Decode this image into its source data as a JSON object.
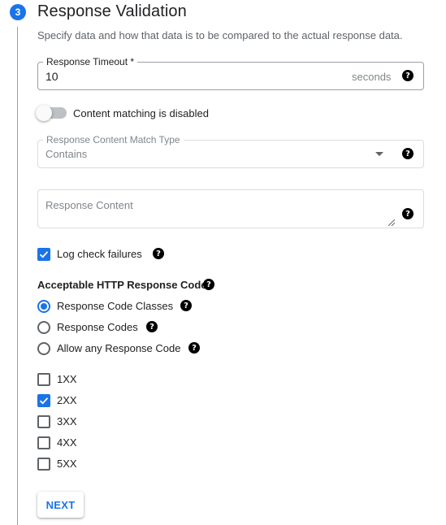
{
  "section": {
    "step_number": "3",
    "title": "Response Validation",
    "subtitle": "Specify data and how that data is to be compared to the actual response data."
  },
  "timeout": {
    "label": "Response Timeout *",
    "value": "10",
    "suffix": "seconds"
  },
  "content_matching": {
    "toggle_label": "Content matching is disabled",
    "enabled": false
  },
  "match_type": {
    "label": "Response Content Match Type",
    "value": "Contains"
  },
  "response_content": {
    "placeholder": "Response Content"
  },
  "log_failures": {
    "label": "Log check failures",
    "checked": true
  },
  "http_codes": {
    "heading": "Acceptable HTTP Response Code",
    "radios": [
      {
        "label": "Response Code Classes",
        "selected": true
      },
      {
        "label": "Response Codes",
        "selected": false
      },
      {
        "label": "Allow any Response Code",
        "selected": false
      }
    ],
    "classes": [
      {
        "label": "1XX",
        "checked": false
      },
      {
        "label": "2XX",
        "checked": true
      },
      {
        "label": "3XX",
        "checked": false
      },
      {
        "label": "4XX",
        "checked": false
      },
      {
        "label": "5XX",
        "checked": false
      }
    ]
  },
  "help_glyph": "?",
  "next_label": "NEXT",
  "colors": {
    "accent": "#1a73e8",
    "text": "#202124",
    "muted": "#5f6368"
  }
}
